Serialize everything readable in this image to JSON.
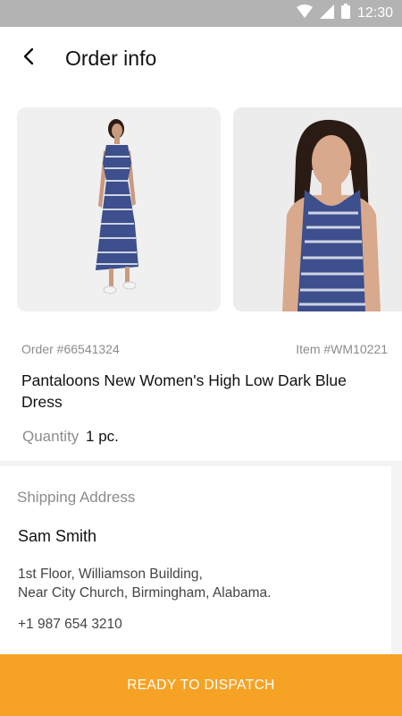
{
  "status_bar": {
    "time": "12:30",
    "icons": [
      "wifi-icon",
      "signal-icon",
      "battery-icon"
    ]
  },
  "app_bar": {
    "title": "Order info",
    "back_icon": "back-arrow-icon"
  },
  "order": {
    "order_number": "Order #66541324",
    "item_number": "Item #WM10221",
    "product_name": "Pantaloons New Women's High Low Dark Blue Dress",
    "quantity_label": "Quantity",
    "quantity_value": "1 pc.",
    "images": [
      "dress-full-length-photo",
      "dress-closeup-photo"
    ]
  },
  "shipping": {
    "heading": "Shipping Address",
    "name": "Sam Smith",
    "address_line1": "1st Floor, Williamson Building,",
    "address_line2": "Near City Church, Birmingham, Alabama.",
    "phone": "+1 987 654 3210"
  },
  "action": {
    "label": "READY TO DISPATCH"
  },
  "colors": {
    "accent": "#f6a325",
    "status_bar": "#b3b3b3",
    "dress_blue": "#3d4f8c"
  }
}
